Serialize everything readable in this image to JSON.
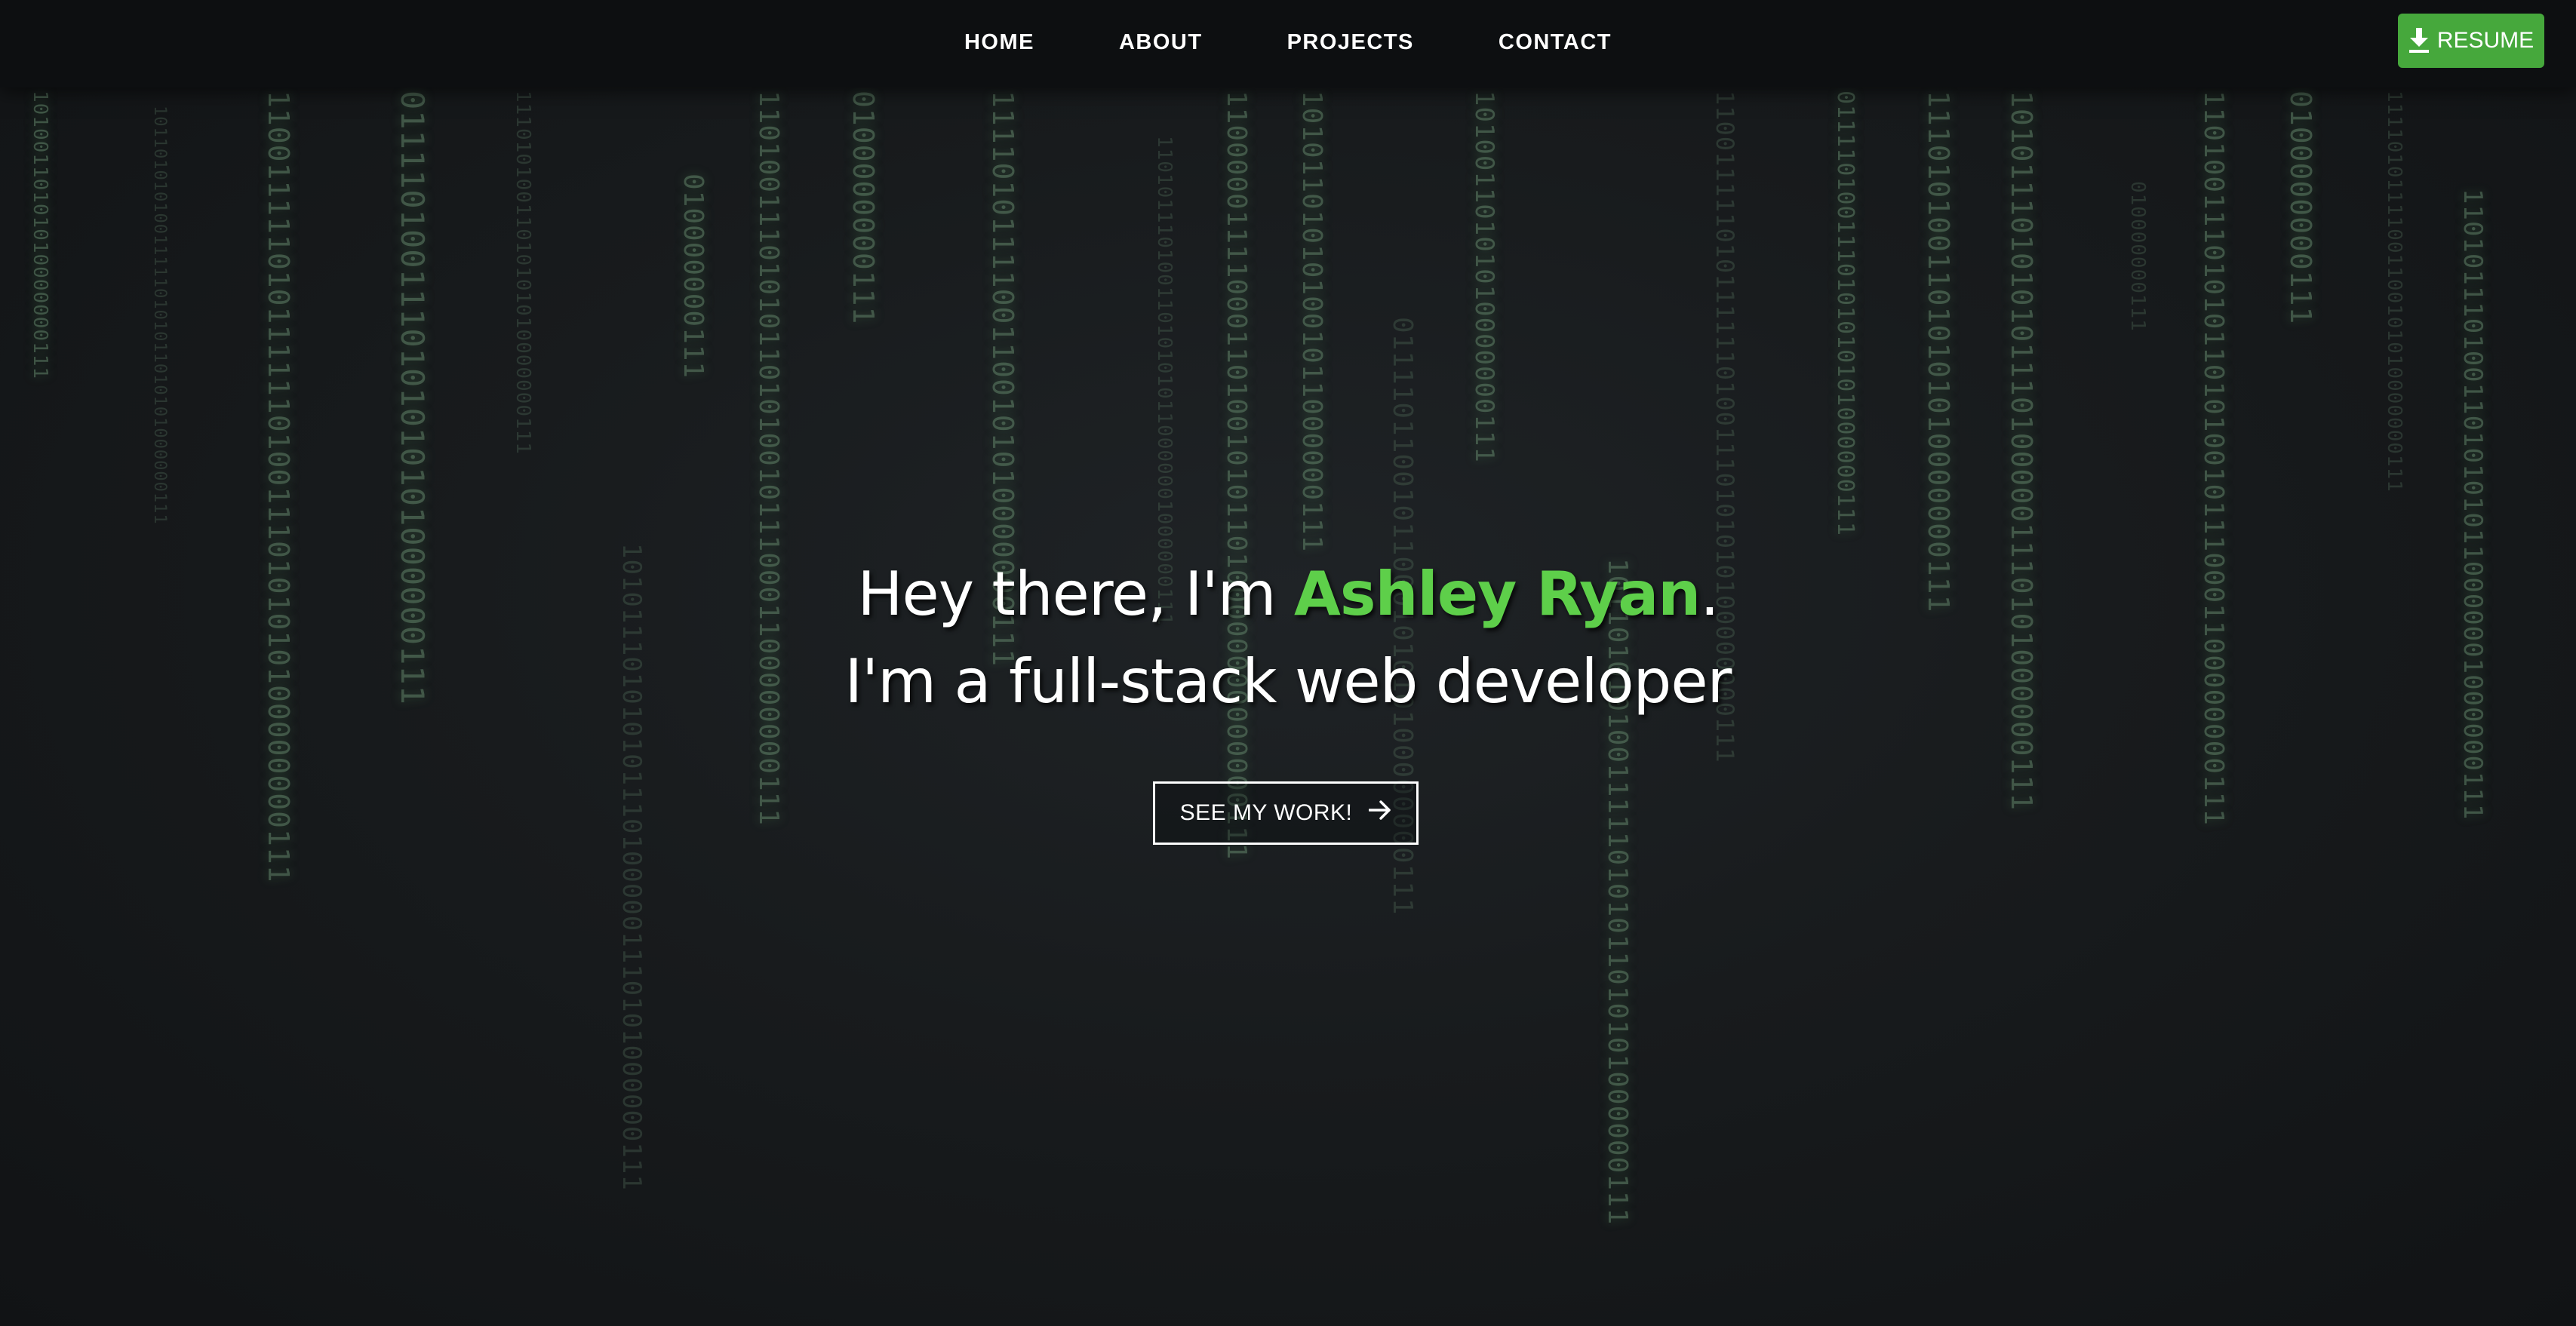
{
  "nav": {
    "links": [
      "HOME",
      "ABOUT",
      "PROJECTS",
      "CONTACT"
    ],
    "resume_label": "RESUME"
  },
  "hero": {
    "greeting_prefix": "Hey there, I'm ",
    "name": "Ashley Ryan",
    "greeting_suffix": ".",
    "subtitle": "I'm a full-stack web developer",
    "cta_label": "SEE MY WORK!"
  },
  "background": {
    "rain_strings": [
      "10100110101010000000111",
      "101101010100111110101011010101000000111",
      "11001111101011111101001110101010100000000111",
      "0111101001110101010101000000111",
      "11101010011010101010000000111",
      "1010111010101011101000001110101000000111",
      "010000000111",
      "1101001110101011010100101110001100000000111",
      "0100000000111",
      "11110101111001100101010000000111",
      "110101110100110101010110000001000000111",
      "110000011110001101001010110100000000000000111",
      "101011010101001011000000111",
      "01111011001011000101010100000000111"
    ],
    "accent_color": "#5ecf4a",
    "button_color": "#46a83c"
  }
}
